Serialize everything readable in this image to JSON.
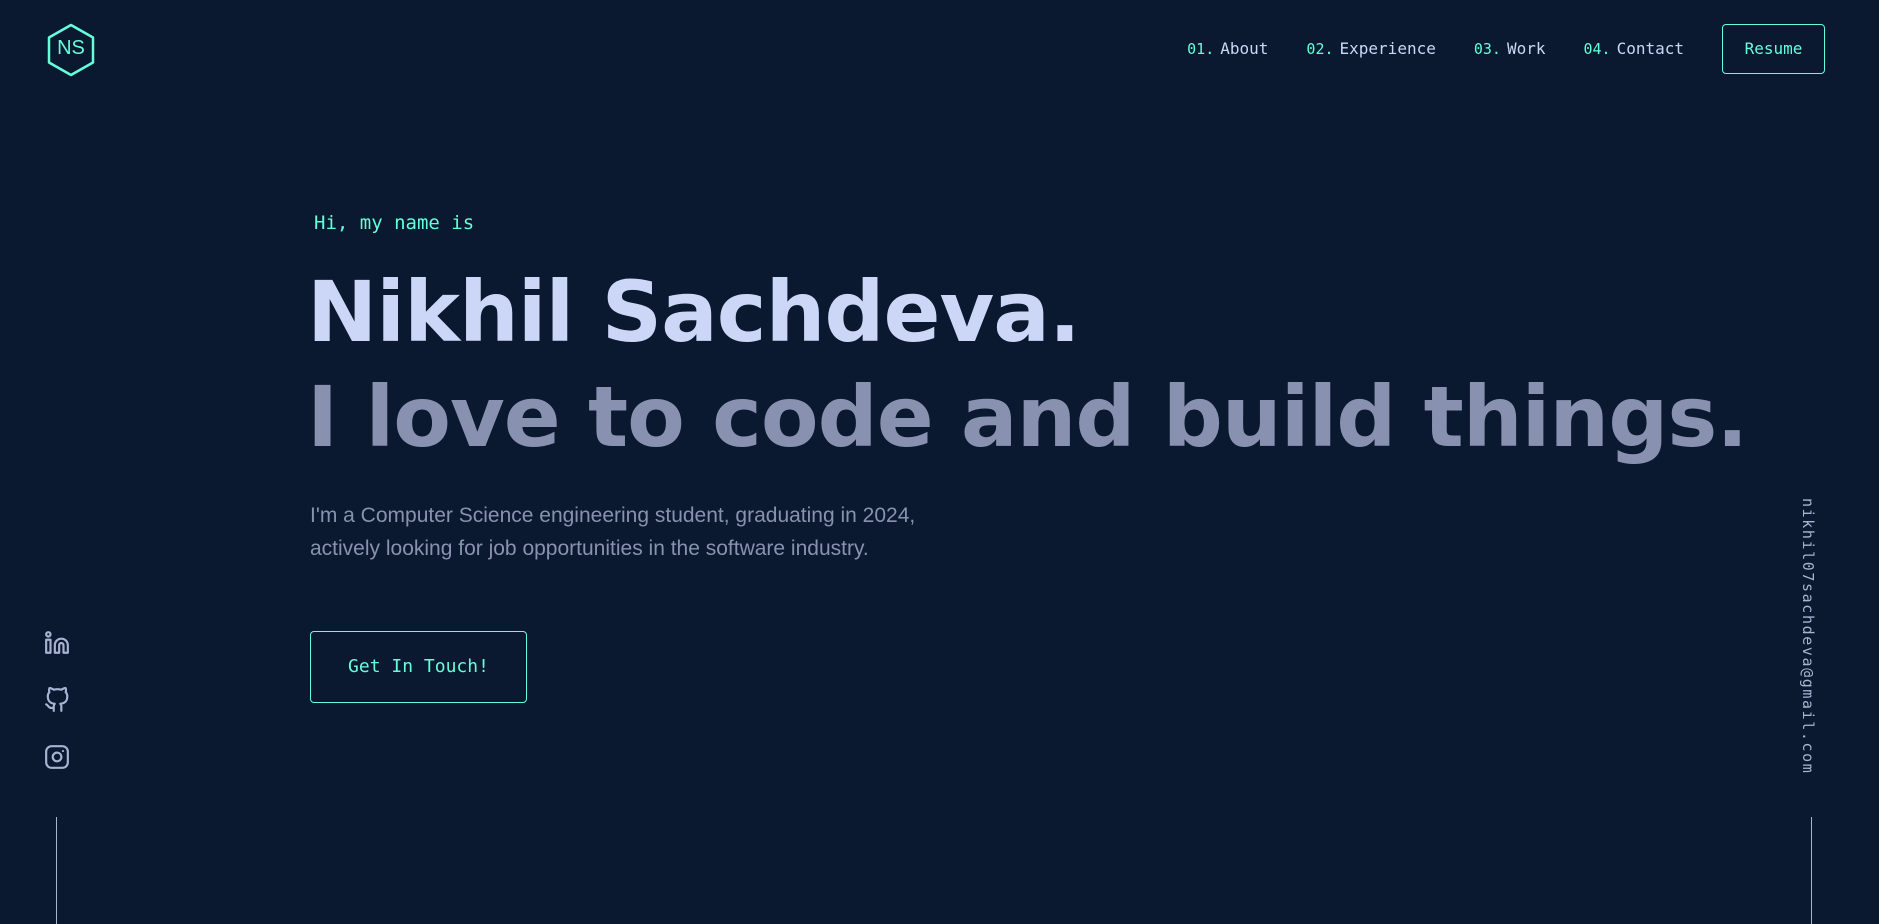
{
  "logo": {
    "text": "NS",
    "icon": "hexagon-logo-icon"
  },
  "nav": {
    "items": [
      {
        "num": "01.",
        "label": "About"
      },
      {
        "num": "02.",
        "label": "Experience"
      },
      {
        "num": "03.",
        "label": "Work"
      },
      {
        "num": "04.",
        "label": "Contact"
      }
    ],
    "resume_label": "Resume"
  },
  "hero": {
    "greeting": "Hi, my name is",
    "name": "Nikhil Sachdeva.",
    "tagline": "I love to code and build things.",
    "intro_line1": "I'm a Computer Science engineering student, graduating in 2024,",
    "intro_line2": "actively looking for job opportunities in the software industry.",
    "cta_label": "Get In Touch!"
  },
  "social": {
    "icons": [
      "linkedin-icon",
      "github-icon",
      "instagram-icon"
    ]
  },
  "email": "nikhil07sachdeva@gmail.com",
  "colors": {
    "background": "#0a192f",
    "accent": "#64ffda",
    "heading": "#ccd6f6",
    "text": "#8892b0",
    "light": "#a8b2d1"
  }
}
